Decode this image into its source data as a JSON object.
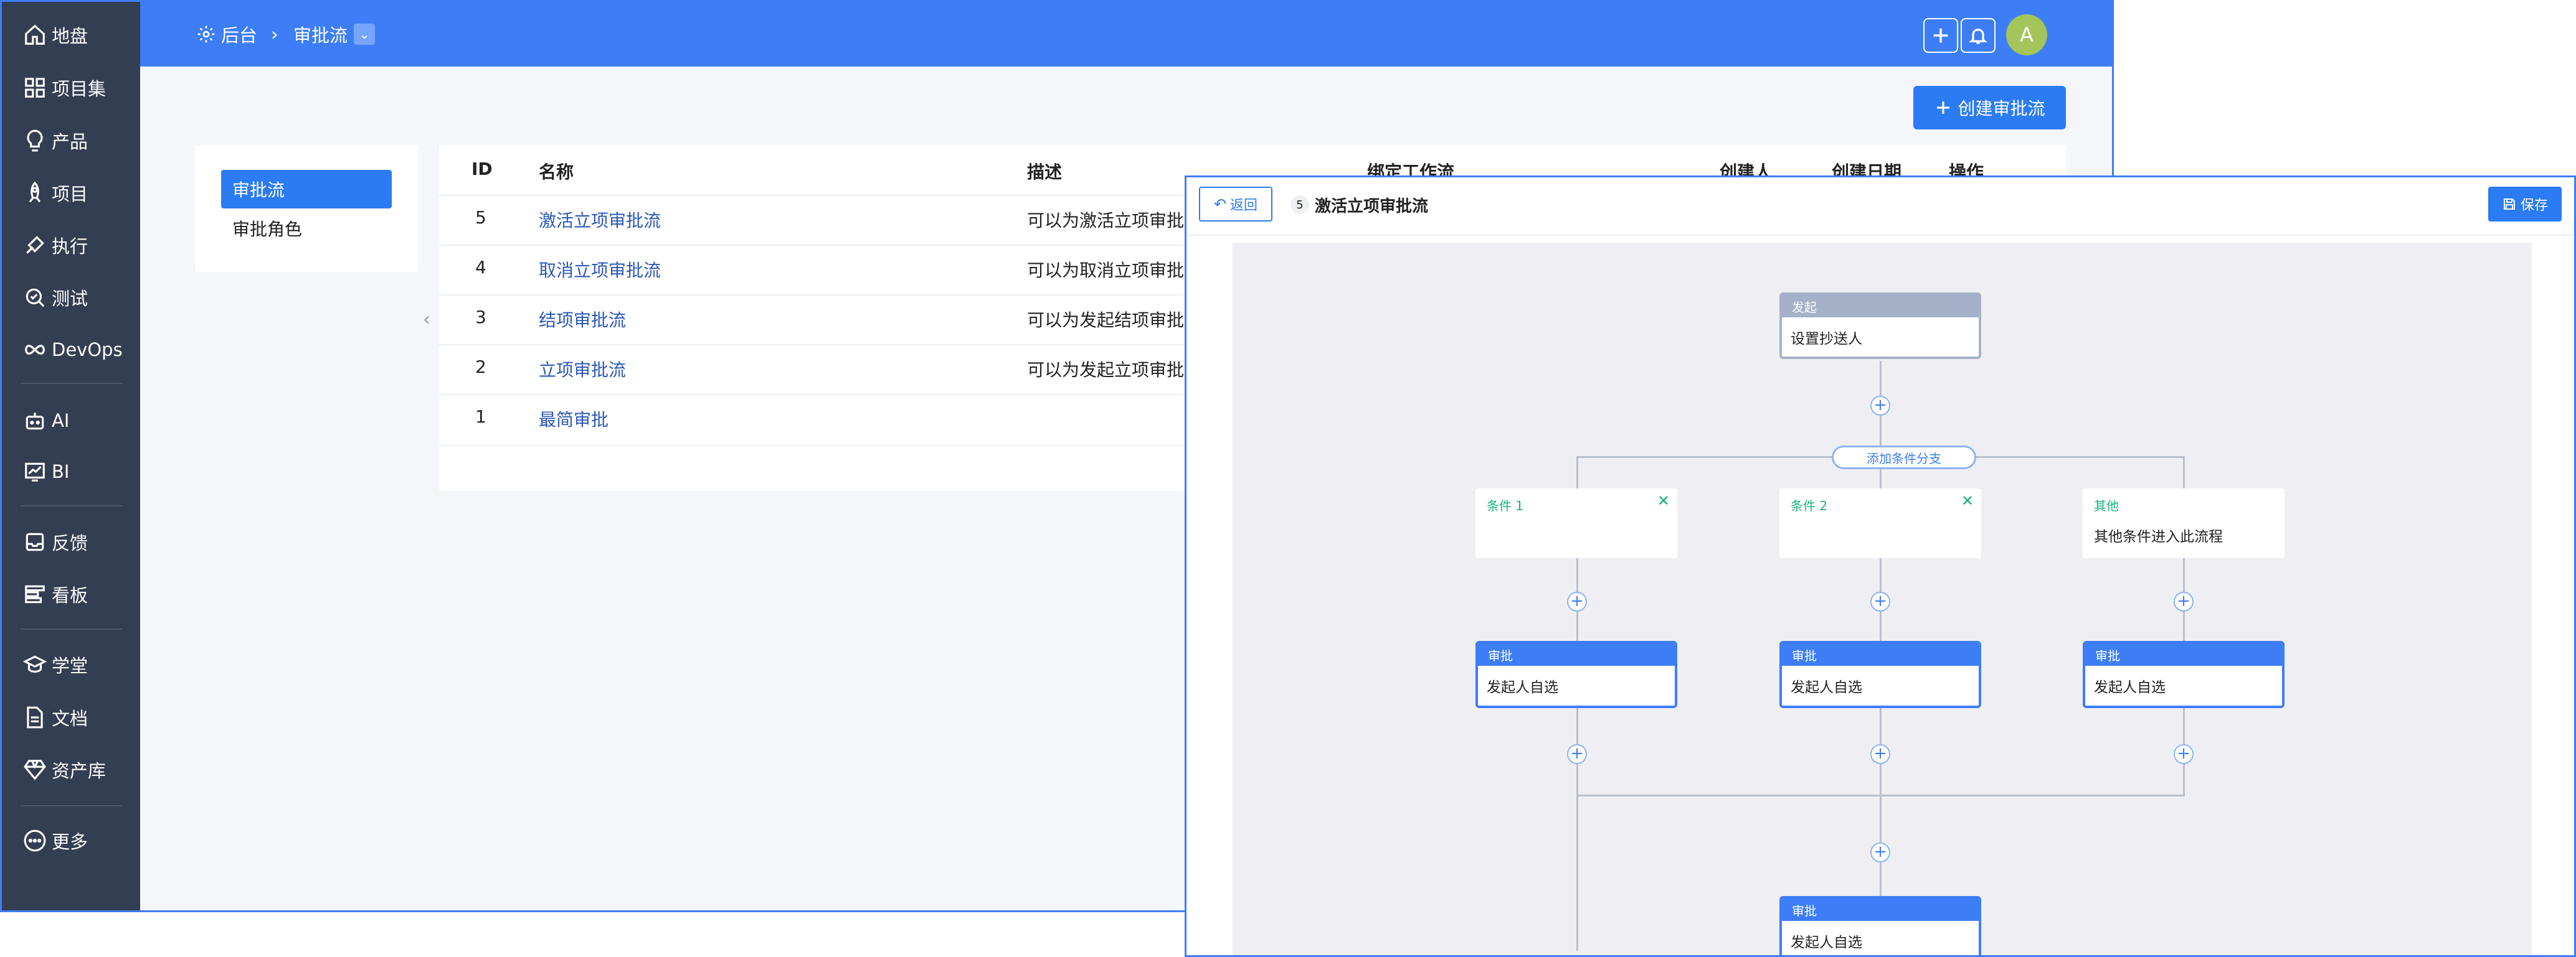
{
  "sidebar": {
    "items": [
      {
        "icon": "home-icon",
        "label": "地盘"
      },
      {
        "icon": "grid-icon",
        "label": "项目集"
      },
      {
        "icon": "bulb-icon",
        "label": "产品"
      },
      {
        "icon": "rocket-icon",
        "label": "项目"
      },
      {
        "icon": "run-icon",
        "label": "执行"
      },
      {
        "icon": "search-check-icon",
        "label": "测试"
      },
      {
        "icon": "infinity-icon",
        "label": "DevOps"
      },
      {
        "icon": "robot-icon",
        "label": "AI"
      },
      {
        "icon": "chart-icon",
        "label": "BI"
      },
      {
        "icon": "feedback-icon",
        "label": "反馈"
      },
      {
        "icon": "kanban-icon",
        "label": "看板"
      },
      {
        "icon": "school-icon",
        "label": "学堂"
      },
      {
        "icon": "document-icon",
        "label": "文档"
      },
      {
        "icon": "gem-icon",
        "label": "资产库"
      },
      {
        "icon": "more-icon",
        "label": "更多"
      }
    ]
  },
  "topbar": {
    "breadcrumb_root": "后台",
    "breadcrumb_current": "审批流"
  },
  "actions": {
    "create_label": "创建审批流"
  },
  "subnav": {
    "items": [
      "审批流",
      "审批角色"
    ]
  },
  "table": {
    "columns": [
      "ID",
      "名称",
      "描述",
      "绑定工作流",
      "创建人",
      "创建日期",
      "操作"
    ],
    "rows": [
      {
        "id": "5",
        "name": "激活立项审批流",
        "desc": "可以为激活立项审批"
      },
      {
        "id": "4",
        "name": "取消立项审批流",
        "desc": "可以为取消立项审批"
      },
      {
        "id": "3",
        "name": "结项审批流",
        "desc": "可以为发起结项审批"
      },
      {
        "id": "2",
        "name": "立项审批流",
        "desc": "可以为发起立项审批"
      },
      {
        "id": "1",
        "name": "最简审批",
        "desc": ""
      }
    ]
  },
  "editor": {
    "back_label": "返回",
    "id_badge": "5",
    "title": "激活立项审批流",
    "save_label": "保存",
    "start_node": {
      "title": "发起",
      "body": "设置抄送人"
    },
    "add_branch_label": "添加条件分支",
    "conditions": [
      {
        "title": "条件 1",
        "body": ""
      },
      {
        "title": "条件 2",
        "body": ""
      },
      {
        "title": "其他",
        "body": "其他条件进入此流程"
      }
    ],
    "approvals": [
      {
        "title": "审批",
        "body": "发起人自选"
      },
      {
        "title": "审批",
        "body": "发起人自选"
      },
      {
        "title": "审批",
        "body": "发起人自选"
      }
    ],
    "final_node": {
      "title": "审批",
      "body": "发起人自选"
    }
  },
  "colors": {
    "accent": "#3d7ef6",
    "sidebar_bg": "#333e52",
    "start_node_head": "#a5b1c8",
    "condition_text": "#15b37a",
    "link": "#2b58b6"
  }
}
